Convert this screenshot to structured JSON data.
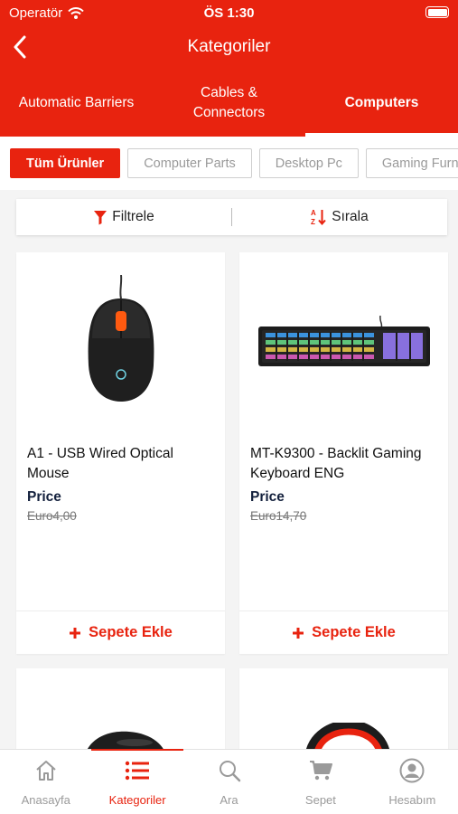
{
  "status_bar": {
    "carrier": "Operatör",
    "time": "ÖS 1:30"
  },
  "nav": {
    "title": "Kategoriler",
    "back_icon": "chevron-left-icon"
  },
  "category_tabs": [
    {
      "label": "Automatic Barriers"
    },
    {
      "label": "Cables & Connectors"
    },
    {
      "label": "Computers"
    }
  ],
  "chips": [
    {
      "label": "Tüm Ürünler"
    },
    {
      "label": "Computer Parts"
    },
    {
      "label": "Desktop Pc"
    },
    {
      "label": "Gaming Furniture"
    }
  ],
  "filter_bar": {
    "filter_label": "Filtrele",
    "sort_label": "Sırala"
  },
  "products": [
    {
      "name": "A1 - USB Wired Optical Mouse",
      "price_label": "Price",
      "old_price": "Euro4,00",
      "cart_label": "Sepete Ekle"
    },
    {
      "name": "MT-K9300 - Backlit Gaming Keyboard ENG",
      "price_label": "Price",
      "old_price": "Euro14,70",
      "cart_label": "Sepete Ekle"
    },
    {
      "name": "",
      "price_label": "",
      "old_price": "",
      "cart_label": ""
    },
    {
      "name": "",
      "price_label": "",
      "old_price": "",
      "cart_label": ""
    }
  ],
  "tab_bar": [
    {
      "label": "Anasayfa",
      "icon": "home-icon"
    },
    {
      "label": "Kategoriler",
      "icon": "list-icon"
    },
    {
      "label": "Ara",
      "icon": "search-icon"
    },
    {
      "label": "Sepet",
      "icon": "cart-icon"
    },
    {
      "label": "Hesabım",
      "icon": "account-icon"
    }
  ],
  "colors": {
    "accent": "#e8230f",
    "price_text": "#14213d",
    "inactive": "#9a9a9a"
  }
}
